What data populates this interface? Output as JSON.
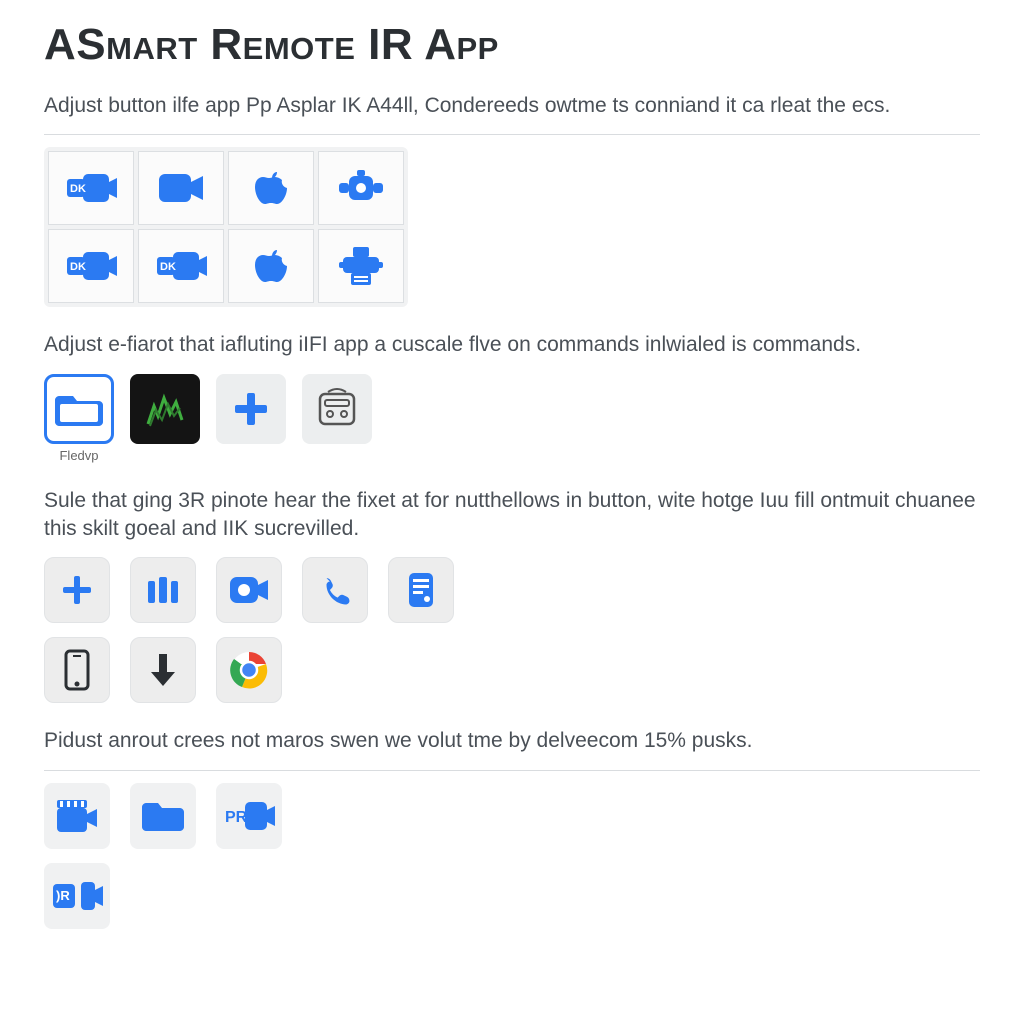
{
  "title": "ASmart Remote IR App",
  "section1": {
    "desc": "Adjust button ilfe app Pp Asplar IK A44ll, Condereeds owtme ts conniand it ca rleat the ecs.",
    "tiles": [
      {
        "name": "dk-camera",
        "badge": "DK"
      },
      {
        "name": "camera"
      },
      {
        "name": "apple"
      },
      {
        "name": "connector"
      },
      {
        "name": "dk-camera-2",
        "badge": "DK"
      },
      {
        "name": "dk-camera-3",
        "badge": "DK"
      },
      {
        "name": "apple-2"
      },
      {
        "name": "printer"
      }
    ]
  },
  "section2": {
    "desc": "Adjust e-fiarot that iafluting iIFI app a cuscale flve on commands inlwialed is commands.",
    "tiles": [
      {
        "name": "folder",
        "caption": "Fledvp"
      },
      {
        "name": "graphic"
      },
      {
        "name": "plus"
      },
      {
        "name": "device"
      }
    ]
  },
  "section3": {
    "desc": "Sule that ging 3R pinote hear the fixet at for nutthellows in button, wite hotge Iuu fill ontmuit chuanee this skilt goeal and IIK sucrevilled.",
    "row1": [
      {
        "name": "plus"
      },
      {
        "name": "group"
      },
      {
        "name": "camera-o"
      },
      {
        "name": "phone"
      },
      {
        "name": "card"
      }
    ],
    "row2": [
      {
        "name": "smartphone"
      },
      {
        "name": "download"
      },
      {
        "name": "chrome"
      }
    ]
  },
  "section4": {
    "desc": "Pidust anrout crees not maros swen we volut tme by delveecom 15% pusks.",
    "row1": [
      {
        "name": "clapper"
      },
      {
        "name": "folder-o"
      },
      {
        "name": "pr-camera",
        "badge": "PR"
      }
    ],
    "row2": [
      {
        "name": "dr-camera",
        "badge": ")R"
      }
    ]
  },
  "colors": {
    "blue": "#2b7af2",
    "dark": "#2b2f33"
  }
}
